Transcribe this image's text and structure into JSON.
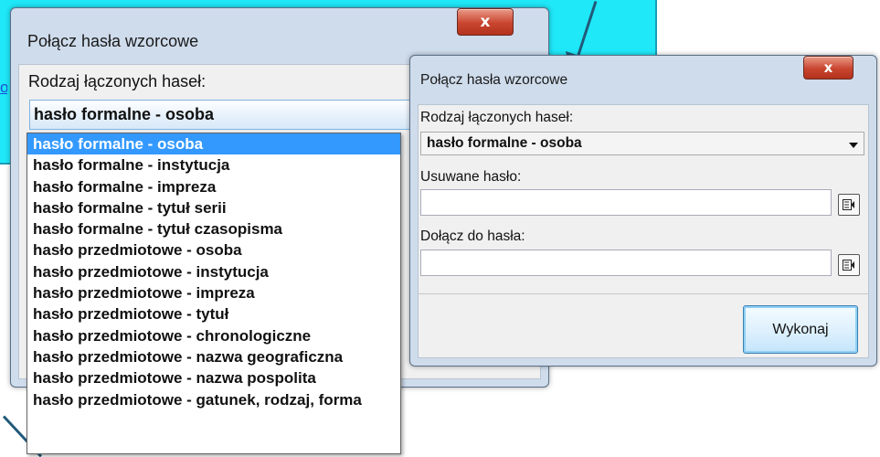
{
  "background": {
    "link_fragment": "o"
  },
  "big_dialog": {
    "title": "Połącz hasła wzorcowe",
    "close_label": "x",
    "combo_label": "Rodzaj łączonych haseł:",
    "combo_value": "hasło formalne - osoba",
    "options": [
      "hasło formalne - osoba",
      "hasło formalne - instytucja",
      "hasło formalne - impreza",
      "hasło formalne - tytuł serii",
      "hasło formalne - tytuł czasopisma",
      "hasło przedmiotowe - osoba",
      "hasło przedmiotowe - instytucja",
      "hasło przedmiotowe - impreza",
      "hasło przedmiotowe - tytuł",
      "hasło przedmiotowe - chronologiczne",
      "hasło przedmiotowe - nazwa geograficzna",
      "hasło przedmiotowe - nazwa pospolita",
      "hasło przedmiotowe - gatunek, rodzaj, forma"
    ],
    "selected_index": 0
  },
  "small_dialog": {
    "title": "Połącz hasła wzorcowe",
    "close_label": "x",
    "combo_label": "Rodzaj łączonych haseł:",
    "combo_value": "hasło formalne - osoba",
    "removed_label": "Usuwane hasło:",
    "removed_value": "",
    "attach_label": "Dołącz do hasła:",
    "attach_value": "",
    "execute_label": "Wykonaj"
  },
  "colors": {
    "accent_background": "#1fe8f8",
    "selection": "#3399ff",
    "close_button": "#c9452f"
  },
  "icons": [
    "close-icon",
    "chevron-down-icon",
    "picker-icon"
  ]
}
